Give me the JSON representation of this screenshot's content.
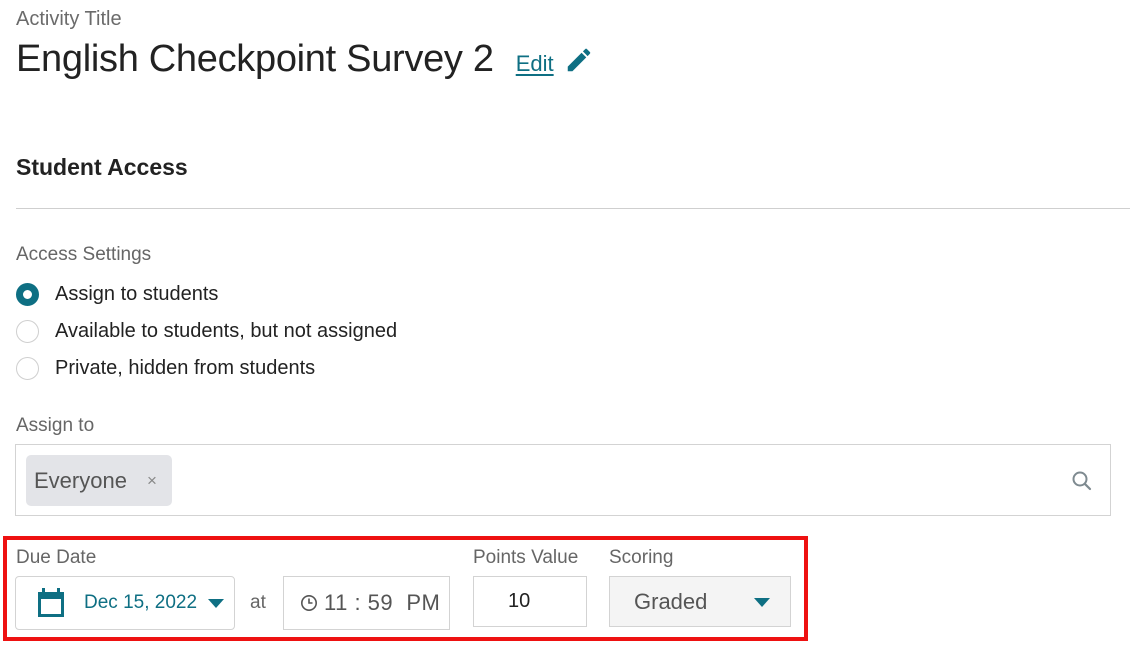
{
  "header": {
    "activity_label": "Activity Title",
    "activity_title": "English Checkpoint Survey 2",
    "edit_label": "Edit"
  },
  "student_access": {
    "section_title": "Student Access",
    "access_settings": {
      "label": "Access Settings",
      "options": [
        {
          "label": "Assign to students",
          "checked": true
        },
        {
          "label": "Available to students, but not assigned",
          "checked": false
        },
        {
          "label": "Private, hidden from students",
          "checked": false
        }
      ]
    },
    "assign_to": {
      "label": "Assign to",
      "chips": [
        {
          "label": "Everyone",
          "remove_symbol": "×"
        }
      ]
    }
  },
  "due": {
    "due_date_label": "Due Date",
    "date_value": "Dec 15, 2022",
    "at_label": "at",
    "time_value": "11 : 59  PM",
    "points_label": "Points Value",
    "points_value": "10",
    "scoring_label": "Scoring",
    "scoring_value": "Graded"
  },
  "colors": {
    "accent": "#0e6f83",
    "highlight": "#ee1111",
    "border": "#d3d3d3"
  }
}
